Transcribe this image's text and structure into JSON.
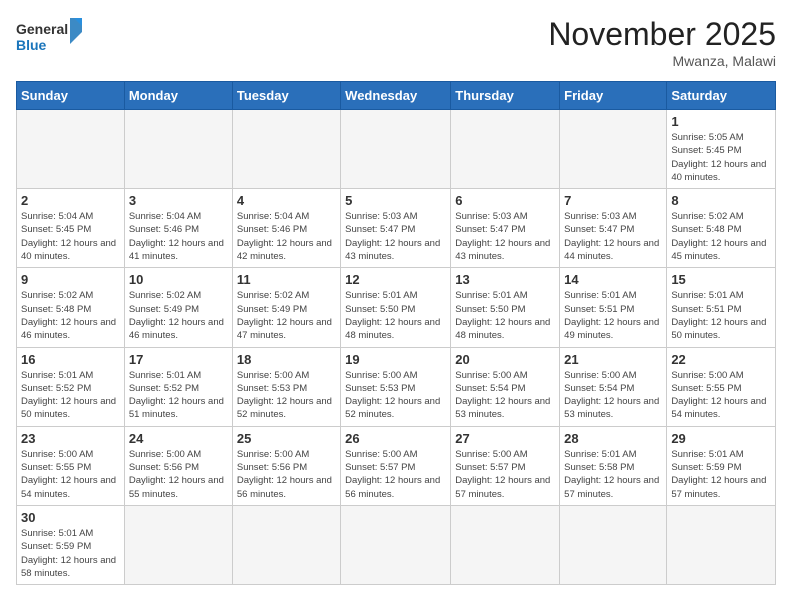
{
  "header": {
    "title": "November 2025",
    "subtitle": "Mwanza, Malawi"
  },
  "logo": {
    "line1": "General",
    "line2": "Blue"
  },
  "weekdays": [
    "Sunday",
    "Monday",
    "Tuesday",
    "Wednesday",
    "Thursday",
    "Friday",
    "Saturday"
  ],
  "weeks": [
    [
      {
        "day": "",
        "info": ""
      },
      {
        "day": "",
        "info": ""
      },
      {
        "day": "",
        "info": ""
      },
      {
        "day": "",
        "info": ""
      },
      {
        "day": "",
        "info": ""
      },
      {
        "day": "",
        "info": ""
      },
      {
        "day": "1",
        "info": "Sunrise: 5:05 AM\nSunset: 5:45 PM\nDaylight: 12 hours\nand 40 minutes."
      }
    ],
    [
      {
        "day": "2",
        "info": "Sunrise: 5:04 AM\nSunset: 5:45 PM\nDaylight: 12 hours\nand 40 minutes."
      },
      {
        "day": "3",
        "info": "Sunrise: 5:04 AM\nSunset: 5:46 PM\nDaylight: 12 hours\nand 41 minutes."
      },
      {
        "day": "4",
        "info": "Sunrise: 5:04 AM\nSunset: 5:46 PM\nDaylight: 12 hours\nand 42 minutes."
      },
      {
        "day": "5",
        "info": "Sunrise: 5:03 AM\nSunset: 5:47 PM\nDaylight: 12 hours\nand 43 minutes."
      },
      {
        "day": "6",
        "info": "Sunrise: 5:03 AM\nSunset: 5:47 PM\nDaylight: 12 hours\nand 43 minutes."
      },
      {
        "day": "7",
        "info": "Sunrise: 5:03 AM\nSunset: 5:47 PM\nDaylight: 12 hours\nand 44 minutes."
      },
      {
        "day": "8",
        "info": "Sunrise: 5:02 AM\nSunset: 5:48 PM\nDaylight: 12 hours\nand 45 minutes."
      }
    ],
    [
      {
        "day": "9",
        "info": "Sunrise: 5:02 AM\nSunset: 5:48 PM\nDaylight: 12 hours\nand 46 minutes."
      },
      {
        "day": "10",
        "info": "Sunrise: 5:02 AM\nSunset: 5:49 PM\nDaylight: 12 hours\nand 46 minutes."
      },
      {
        "day": "11",
        "info": "Sunrise: 5:02 AM\nSunset: 5:49 PM\nDaylight: 12 hours\nand 47 minutes."
      },
      {
        "day": "12",
        "info": "Sunrise: 5:01 AM\nSunset: 5:50 PM\nDaylight: 12 hours\nand 48 minutes."
      },
      {
        "day": "13",
        "info": "Sunrise: 5:01 AM\nSunset: 5:50 PM\nDaylight: 12 hours\nand 48 minutes."
      },
      {
        "day": "14",
        "info": "Sunrise: 5:01 AM\nSunset: 5:51 PM\nDaylight: 12 hours\nand 49 minutes."
      },
      {
        "day": "15",
        "info": "Sunrise: 5:01 AM\nSunset: 5:51 PM\nDaylight: 12 hours\nand 50 minutes."
      }
    ],
    [
      {
        "day": "16",
        "info": "Sunrise: 5:01 AM\nSunset: 5:52 PM\nDaylight: 12 hours\nand 50 minutes."
      },
      {
        "day": "17",
        "info": "Sunrise: 5:01 AM\nSunset: 5:52 PM\nDaylight: 12 hours\nand 51 minutes."
      },
      {
        "day": "18",
        "info": "Sunrise: 5:00 AM\nSunset: 5:53 PM\nDaylight: 12 hours\nand 52 minutes."
      },
      {
        "day": "19",
        "info": "Sunrise: 5:00 AM\nSunset: 5:53 PM\nDaylight: 12 hours\nand 52 minutes."
      },
      {
        "day": "20",
        "info": "Sunrise: 5:00 AM\nSunset: 5:54 PM\nDaylight: 12 hours\nand 53 minutes."
      },
      {
        "day": "21",
        "info": "Sunrise: 5:00 AM\nSunset: 5:54 PM\nDaylight: 12 hours\nand 53 minutes."
      },
      {
        "day": "22",
        "info": "Sunrise: 5:00 AM\nSunset: 5:55 PM\nDaylight: 12 hours\nand 54 minutes."
      }
    ],
    [
      {
        "day": "23",
        "info": "Sunrise: 5:00 AM\nSunset: 5:55 PM\nDaylight: 12 hours\nand 54 minutes."
      },
      {
        "day": "24",
        "info": "Sunrise: 5:00 AM\nSunset: 5:56 PM\nDaylight: 12 hours\nand 55 minutes."
      },
      {
        "day": "25",
        "info": "Sunrise: 5:00 AM\nSunset: 5:56 PM\nDaylight: 12 hours\nand 56 minutes."
      },
      {
        "day": "26",
        "info": "Sunrise: 5:00 AM\nSunset: 5:57 PM\nDaylight: 12 hours\nand 56 minutes."
      },
      {
        "day": "27",
        "info": "Sunrise: 5:00 AM\nSunset: 5:57 PM\nDaylight: 12 hours\nand 57 minutes."
      },
      {
        "day": "28",
        "info": "Sunrise: 5:01 AM\nSunset: 5:58 PM\nDaylight: 12 hours\nand 57 minutes."
      },
      {
        "day": "29",
        "info": "Sunrise: 5:01 AM\nSunset: 5:59 PM\nDaylight: 12 hours\nand 57 minutes."
      }
    ],
    [
      {
        "day": "30",
        "info": "Sunrise: 5:01 AM\nSunset: 5:59 PM\nDaylight: 12 hours\nand 58 minutes."
      },
      {
        "day": "",
        "info": ""
      },
      {
        "day": "",
        "info": ""
      },
      {
        "day": "",
        "info": ""
      },
      {
        "day": "",
        "info": ""
      },
      {
        "day": "",
        "info": ""
      },
      {
        "day": "",
        "info": ""
      }
    ]
  ]
}
